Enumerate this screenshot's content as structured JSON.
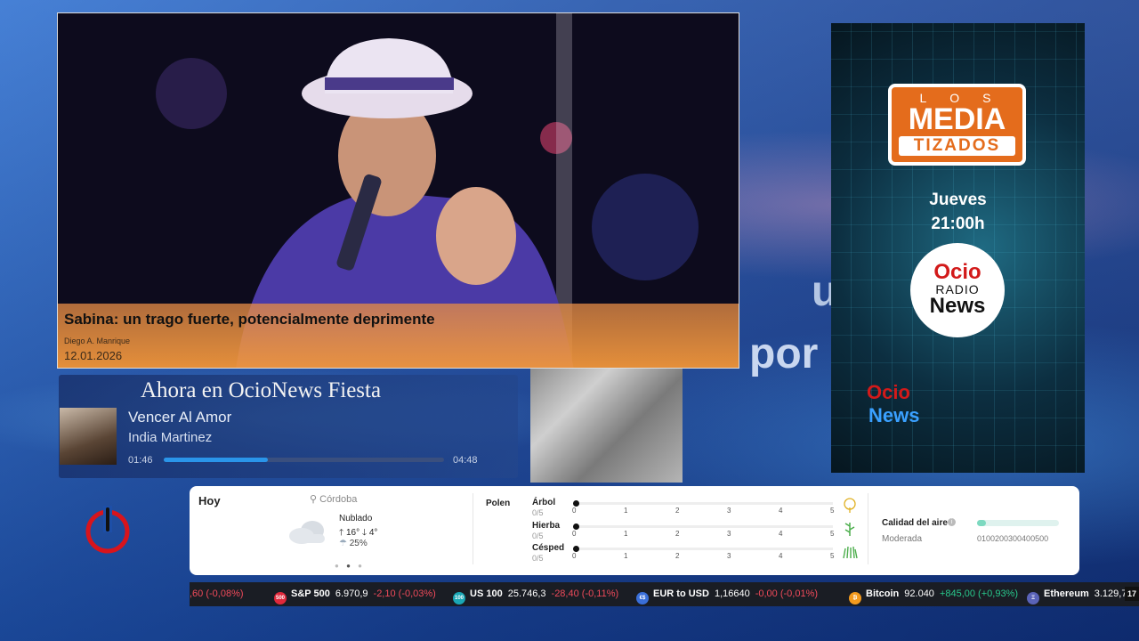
{
  "background": {
    "word1": "u",
    "word2": "por"
  },
  "article": {
    "headline": "Sabina: un trago fuerte, potencialmente deprimente",
    "author": "Diego A. Manrique",
    "date": "12.01.2026"
  },
  "player": {
    "title": "Ahora en OcioNews Fiesta",
    "song": "Vencer Al Amor",
    "artist": "India Martinez",
    "elapsed": "01:46",
    "duration": "04:48",
    "progress": 0.37
  },
  "poster": {
    "los": "LOS",
    "media": "MEDIA",
    "tizados": "TIZADOS",
    "day": "Jueves",
    "hour": "21:00h",
    "radio_ocio": "Ocio",
    "radio_radio": "RADIO",
    "radio_news": "News",
    "small_ocio": "Ocio",
    "small_news": "News"
  },
  "weather": {
    "today": "Hoy",
    "location": "Córdoba",
    "condition": "Nublado",
    "temps": "🡑 16° 🡓 4°",
    "rain": "25%",
    "polen_label": "Polen",
    "pollen": [
      {
        "name": "Árbol",
        "value": "0/5"
      },
      {
        "name": "Hierba",
        "value": "0/5"
      },
      {
        "name": "Césped",
        "value": "0/5"
      }
    ],
    "ticks": [
      "0",
      "1",
      "2",
      "3",
      "4",
      "5"
    ],
    "air_quality_label": "Calidad del aire",
    "air_quality_value": "Moderada",
    "air_scale": "0100200300400500"
  },
  "ticker": {
    "items": [
      {
        "name": "",
        "price": "",
        "change": ",60 (-0,08%)",
        "dir": "neg"
      },
      {
        "badge": "500",
        "badge_color": "#e0283a",
        "name": "S&P 500",
        "price": "6.970,9",
        "change": "-2,10 (-0,03%)",
        "dir": "neg"
      },
      {
        "badge": "100",
        "badge_color": "#1aa7b5",
        "name": "US 100",
        "price": "25.746,3",
        "change": "-28,40 (-0,11%)",
        "dir": "neg"
      },
      {
        "badge": "€$",
        "badge_color": "#3a6fd8",
        "name": "EUR to USD",
        "price": "1,16640",
        "change": "-0,00 (-0,01%)",
        "dir": "neg"
      },
      {
        "badge": "₿",
        "badge_color": "#f39a1d",
        "name": "Bitcoin",
        "price": "92.040",
        "change": "+845,00 (+0,93%)",
        "dir": "pos"
      },
      {
        "badge": "Ξ",
        "badge_color": "#5a63b8",
        "name": "Ethereum",
        "price": "3.129,7",
        "change": "",
        "dir": "pos"
      }
    ],
    "brand": "17"
  },
  "colors": {
    "accent_orange": "#e46c1c",
    "progress_blue": "#2a95ea",
    "negative": "#f04a5a",
    "positive": "#28c88c"
  }
}
